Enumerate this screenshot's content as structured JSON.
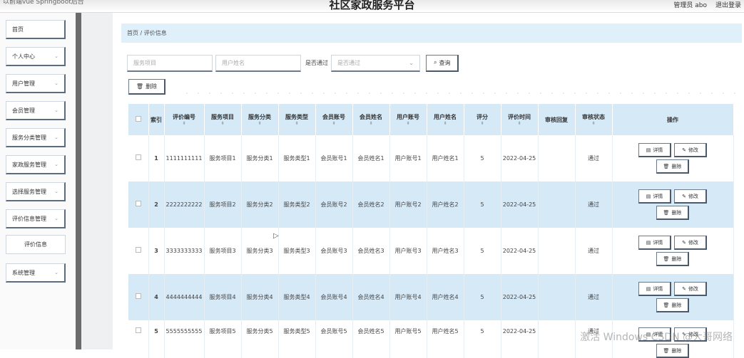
{
  "header": {
    "system_left": "以前端vue Springboot后台",
    "site_title": "社区家政服务平台",
    "admin": "管理员 abo",
    "logout": "退出登录"
  },
  "sidebar": {
    "items": [
      {
        "label": "首页",
        "chevron": false
      },
      {
        "label": "个人中心",
        "chevron": true
      },
      {
        "label": "用户管理",
        "chevron": true
      },
      {
        "label": "会员管理",
        "chevron": true
      },
      {
        "label": "服务分类管理",
        "chevron": true
      },
      {
        "label": "家政服务管理",
        "chevron": true
      },
      {
        "label": "选择服务管理",
        "chevron": true
      },
      {
        "label": "评价信息管理",
        "chevron": true
      }
    ],
    "active_sub": "评价信息",
    "system_item": "系统管理"
  },
  "breadcrumb": "首页 / 评价信息",
  "search": {
    "service_placeholder": "服务项目",
    "user_placeholder": "用户姓名",
    "approval_label": "是否通过",
    "approval_placeholder": "是否通过",
    "query_label": "查询",
    "query_icon": "search-icon"
  },
  "toolbar": {
    "delete_label": "删除",
    "delete_icon": "trash-icon"
  },
  "table": {
    "headers": [
      "索引",
      "评价编号",
      "服务项目",
      "服务分类",
      "服务类型",
      "会员账号",
      "会员姓名",
      "用户账号",
      "用户姓名",
      "评分",
      "评价时间",
      "审核回复",
      "审核状态",
      "操作"
    ],
    "actions": {
      "detail": "详情",
      "edit": "修改",
      "delete": "删除"
    },
    "rows": [
      {
        "index": "1",
        "code": "1111111111",
        "service_item": "服务项目1",
        "service_category": "服务分类1",
        "service_type": "服务类型1",
        "member_account": "会员账号1",
        "member_name": "会员姓名1",
        "user_account": "用户账号1",
        "user_name": "用户姓名1",
        "score": "5",
        "time": "2022-04-25",
        "reply": "",
        "status": "通过"
      },
      {
        "index": "2",
        "code": "2222222222",
        "service_item": "服务项目2",
        "service_category": "服务分类2",
        "service_type": "服务类型2",
        "member_account": "会员账号2",
        "member_name": "会员姓名2",
        "user_account": "用户账号2",
        "user_name": "用户姓名2",
        "score": "5",
        "time": "2022-04-25",
        "reply": "",
        "status": "通过"
      },
      {
        "index": "3",
        "code": "3333333333",
        "service_item": "服务项目3",
        "service_category": "服务分类3",
        "service_type": "服务类型3",
        "member_account": "会员账号3",
        "member_name": "会员姓名3",
        "user_account": "用户账号3",
        "user_name": "用户姓名3",
        "score": "5",
        "time": "2022-04-25",
        "reply": "",
        "status": "通过"
      },
      {
        "index": "4",
        "code": "4444444444",
        "service_item": "服务项目4",
        "service_category": "服务分类4",
        "service_type": "服务类型4",
        "member_account": "会员账号4",
        "member_name": "会员姓名4",
        "user_account": "用户账号4",
        "user_name": "用户姓名4",
        "score": "5",
        "time": "2022-04-25",
        "reply": "",
        "status": "通过"
      },
      {
        "index": "5",
        "code": "5555555555",
        "service_item": "服务项目5",
        "service_category": "服务分类5",
        "service_type": "服务类型5",
        "member_account": "会员账号5",
        "member_name": "会员姓名5",
        "user_account": "用户账号5",
        "user_name": "用户姓名5",
        "score": "5",
        "time": "2022-04-25",
        "reply": "",
        "status": "通过"
      }
    ]
  },
  "watermark": "激活 Windows  CSDN @大哥网络"
}
